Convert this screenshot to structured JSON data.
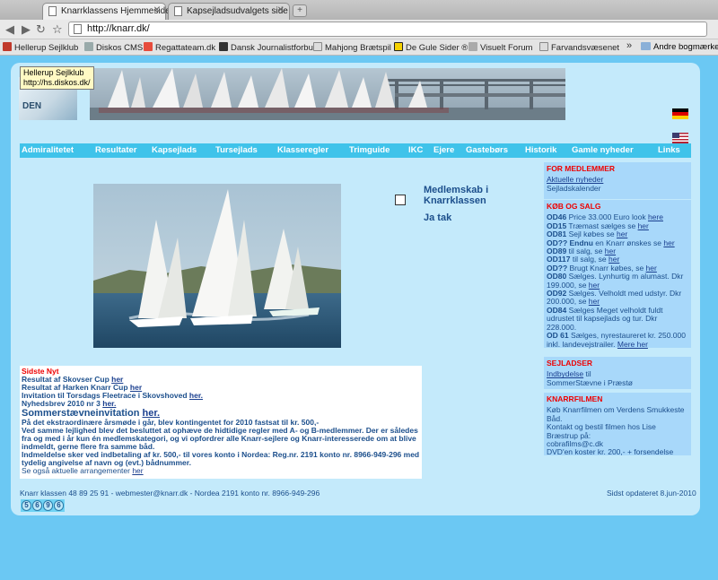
{
  "browser": {
    "tabs": [
      {
        "title": "Knarrklassens Hjemmeside",
        "active": true
      },
      {
        "title": "Kapsejladsudvalgets side",
        "active": false
      }
    ],
    "url": "http://knarr.dk/",
    "bookmarks": [
      "Hellerup Sejlklub",
      "Diskos CMS",
      "Regattateam.dk",
      "Dansk Journalistforbu",
      "Mahjong Brætspil",
      "De Gule Sider ®",
      "Visuelt Forum",
      "Farvandsvæsenet"
    ],
    "bookmarks_more": "»",
    "other_bookmarks": "Andre bogmærker"
  },
  "tooltip": {
    "line1": "Hellerup Sejlklub",
    "line2": "http://hs.diskos.dk/"
  },
  "logo_text": "DEN",
  "nav": [
    "Admiralitetet",
    "Resultater",
    "Kapsejlads",
    "Tursejlads",
    "Klasseregler",
    "Trimguide",
    "IKC",
    "Ejere",
    "Gastebørs",
    "Historik",
    "Gamle nyheder",
    "Links"
  ],
  "membership": {
    "line1": "Medlemskab i",
    "line2": "Knarrklassen",
    "yes": "Ja tak"
  },
  "news": {
    "heading": "Sidste Nyt",
    "line1_text": "Resultat af Skovser Cup ",
    "line1_link": "her",
    "line2_text": "Resultat af Harken Knarr Cup ",
    "line2_link": "her",
    "line3_text": "Invitation til Torsdags Fleetrace i Skovshoved ",
    "line3_link": "her.",
    "line4_text": "Nyhedsbrev 2010 nr 3  ",
    "line4_link": "her.",
    "line5_text": "Sommerstævneinvitation ",
    "line5_link": "her.",
    "para1": "På det ekstraordinære årsmøde i går, blev kontingentet for 2010 fastsat til kr. 500,-",
    "para2": "Ved samme lejlighed blev det besluttet at ophæve de hidtidige regler med A- og B-medlemmer. Der er således fra og med i år kun én medlemskategori, og vi opfordrer alle Knarr-sejlere og Knarr-interesserede om at blive indmeldt, gerne flere fra samme båd.",
    "para3": "Indmeldelse sker ved indbetaling af kr. 500,- til vores konto i Nordea: Reg.nr. 2191 konto nr. 8966-949-296 med tydelig angivelse af navn og (evt.) bådnummer.",
    "last_text": "Se også aktuelle arrangementer ",
    "last_link": "her"
  },
  "sidebar": {
    "members": {
      "title": "FOR MEDLEMMER",
      "link1": "Aktuelle nyheder",
      "link2": "Sejladskalender"
    },
    "sale": {
      "title": "KØB OG SALG",
      "items": [
        {
          "id": "OD46",
          "text": " Price 33.000 Euro look ",
          "link": "here"
        },
        {
          "id": "OD15",
          "text": " Træmast sælges se ",
          "link": "her"
        },
        {
          "id": "OD81",
          "text": " Sejl købes se ",
          "link": "her"
        },
        {
          "id": "OD?? Endnu",
          "text": " en Knarr ønskes se ",
          "link": "her"
        },
        {
          "id": "OD89",
          "text": " til salg, se ",
          "link": "her"
        },
        {
          "id": "OD117",
          "text": " til salg, se ",
          "link": "her"
        },
        {
          "id": "OD??",
          "text": " Brugt Knarr købes, se ",
          "link": "her"
        },
        {
          "id": "OD80",
          "text": " Sælges. Lynhurtig m alumast. Dkr 199.000, se ",
          "link": "her"
        },
        {
          "id": "OD92",
          "text": " Sælges. Velholdt med udstyr. Dkr 200.000, se ",
          "link": "her"
        },
        {
          "id": "OD84",
          "text": " Sælges Meget velholdt fuldt udrustet til kapsejlads og tur. Dkr 228.000.",
          "link": ""
        },
        {
          "id": "OD 61",
          "text": " Sælges, nyrestaureret kr. 250.000 inkl. landevejstrailer. ",
          "link": "Mere her"
        }
      ]
    },
    "sailing": {
      "title": "SEJLADSER",
      "link1": "Indbydelse",
      "text1": " til",
      "text2": "SommerStævne i Præstø"
    },
    "film": {
      "title": "KNARRFILMEN",
      "line1": "Køb Knarrfilmen om Verdens Smukkeste Båd.",
      "line2": "Kontakt og bestil filmen hos Lise Bræstrup på:",
      "line3": "cobrafilms@c.dk",
      "line4": "DVD'en koster kr. 200,- + forsendelse"
    }
  },
  "footer": {
    "left": "Knarr klassen 48 89 25 91 - webmester@knarr.dk - Nordea 2191 konto nr. 8966-949-296",
    "right": "Sidst opdateret 8.jun-2010"
  },
  "counter": [
    "5",
    "6",
    "9",
    "6"
  ]
}
